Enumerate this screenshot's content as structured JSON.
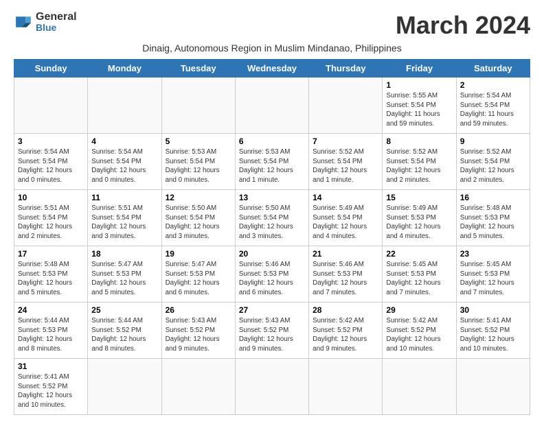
{
  "header": {
    "logo_line1": "General",
    "logo_line2": "Blue",
    "month_title": "March 2024",
    "subtitle": "Dinaig, Autonomous Region in Muslim Mindanao, Philippines"
  },
  "day_headers": [
    "Sunday",
    "Monday",
    "Tuesday",
    "Wednesday",
    "Thursday",
    "Friday",
    "Saturday"
  ],
  "weeks": [
    [
      {
        "day": "",
        "info": ""
      },
      {
        "day": "",
        "info": ""
      },
      {
        "day": "",
        "info": ""
      },
      {
        "day": "",
        "info": ""
      },
      {
        "day": "",
        "info": ""
      },
      {
        "day": "1",
        "info": "Sunrise: 5:55 AM\nSunset: 5:54 PM\nDaylight: 11 hours\nand 59 minutes."
      },
      {
        "day": "2",
        "info": "Sunrise: 5:54 AM\nSunset: 5:54 PM\nDaylight: 11 hours\nand 59 minutes."
      }
    ],
    [
      {
        "day": "3",
        "info": "Sunrise: 5:54 AM\nSunset: 5:54 PM\nDaylight: 12 hours\nand 0 minutes."
      },
      {
        "day": "4",
        "info": "Sunrise: 5:54 AM\nSunset: 5:54 PM\nDaylight: 12 hours\nand 0 minutes."
      },
      {
        "day": "5",
        "info": "Sunrise: 5:53 AM\nSunset: 5:54 PM\nDaylight: 12 hours\nand 0 minutes."
      },
      {
        "day": "6",
        "info": "Sunrise: 5:53 AM\nSunset: 5:54 PM\nDaylight: 12 hours\nand 1 minute."
      },
      {
        "day": "7",
        "info": "Sunrise: 5:52 AM\nSunset: 5:54 PM\nDaylight: 12 hours\nand 1 minute."
      },
      {
        "day": "8",
        "info": "Sunrise: 5:52 AM\nSunset: 5:54 PM\nDaylight: 12 hours\nand 2 minutes."
      },
      {
        "day": "9",
        "info": "Sunrise: 5:52 AM\nSunset: 5:54 PM\nDaylight: 12 hours\nand 2 minutes."
      }
    ],
    [
      {
        "day": "10",
        "info": "Sunrise: 5:51 AM\nSunset: 5:54 PM\nDaylight: 12 hours\nand 2 minutes."
      },
      {
        "day": "11",
        "info": "Sunrise: 5:51 AM\nSunset: 5:54 PM\nDaylight: 12 hours\nand 3 minutes."
      },
      {
        "day": "12",
        "info": "Sunrise: 5:50 AM\nSunset: 5:54 PM\nDaylight: 12 hours\nand 3 minutes."
      },
      {
        "day": "13",
        "info": "Sunrise: 5:50 AM\nSunset: 5:54 PM\nDaylight: 12 hours\nand 3 minutes."
      },
      {
        "day": "14",
        "info": "Sunrise: 5:49 AM\nSunset: 5:54 PM\nDaylight: 12 hours\nand 4 minutes."
      },
      {
        "day": "15",
        "info": "Sunrise: 5:49 AM\nSunset: 5:53 PM\nDaylight: 12 hours\nand 4 minutes."
      },
      {
        "day": "16",
        "info": "Sunrise: 5:48 AM\nSunset: 5:53 PM\nDaylight: 12 hours\nand 5 minutes."
      }
    ],
    [
      {
        "day": "17",
        "info": "Sunrise: 5:48 AM\nSunset: 5:53 PM\nDaylight: 12 hours\nand 5 minutes."
      },
      {
        "day": "18",
        "info": "Sunrise: 5:47 AM\nSunset: 5:53 PM\nDaylight: 12 hours\nand 5 minutes."
      },
      {
        "day": "19",
        "info": "Sunrise: 5:47 AM\nSunset: 5:53 PM\nDaylight: 12 hours\nand 6 minutes."
      },
      {
        "day": "20",
        "info": "Sunrise: 5:46 AM\nSunset: 5:53 PM\nDaylight: 12 hours\nand 6 minutes."
      },
      {
        "day": "21",
        "info": "Sunrise: 5:46 AM\nSunset: 5:53 PM\nDaylight: 12 hours\nand 7 minutes."
      },
      {
        "day": "22",
        "info": "Sunrise: 5:45 AM\nSunset: 5:53 PM\nDaylight: 12 hours\nand 7 minutes."
      },
      {
        "day": "23",
        "info": "Sunrise: 5:45 AM\nSunset: 5:53 PM\nDaylight: 12 hours\nand 7 minutes."
      }
    ],
    [
      {
        "day": "24",
        "info": "Sunrise: 5:44 AM\nSunset: 5:53 PM\nDaylight: 12 hours\nand 8 minutes."
      },
      {
        "day": "25",
        "info": "Sunrise: 5:44 AM\nSunset: 5:52 PM\nDaylight: 12 hours\nand 8 minutes."
      },
      {
        "day": "26",
        "info": "Sunrise: 5:43 AM\nSunset: 5:52 PM\nDaylight: 12 hours\nand 9 minutes."
      },
      {
        "day": "27",
        "info": "Sunrise: 5:43 AM\nSunset: 5:52 PM\nDaylight: 12 hours\nand 9 minutes."
      },
      {
        "day": "28",
        "info": "Sunrise: 5:42 AM\nSunset: 5:52 PM\nDaylight: 12 hours\nand 9 minutes."
      },
      {
        "day": "29",
        "info": "Sunrise: 5:42 AM\nSunset: 5:52 PM\nDaylight: 12 hours\nand 10 minutes."
      },
      {
        "day": "30",
        "info": "Sunrise: 5:41 AM\nSunset: 5:52 PM\nDaylight: 12 hours\nand 10 minutes."
      }
    ],
    [
      {
        "day": "31",
        "info": "Sunrise: 5:41 AM\nSunset: 5:52 PM\nDaylight: 12 hours\nand 10 minutes."
      },
      {
        "day": "",
        "info": ""
      },
      {
        "day": "",
        "info": ""
      },
      {
        "day": "",
        "info": ""
      },
      {
        "day": "",
        "info": ""
      },
      {
        "day": "",
        "info": ""
      },
      {
        "day": "",
        "info": ""
      }
    ]
  ]
}
